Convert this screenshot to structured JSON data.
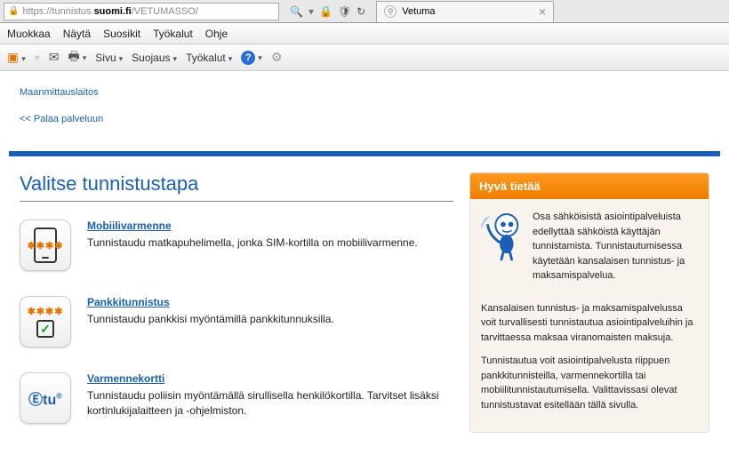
{
  "browser": {
    "url_prefix": "https://tunnistus.",
    "url_bold": "suomi.fi",
    "url_suffix": "/VETUMASSO/",
    "tab_title": "Vetuma"
  },
  "menubar": {
    "items": [
      "Muokkaa",
      "Näytä",
      "Suosikit",
      "Työkalut",
      "Ohje"
    ]
  },
  "toolbar": {
    "page": "Sivu",
    "protect": "Suojaus",
    "tools": "Työkalut"
  },
  "header": {
    "brand": "Maanmittauslaitos",
    "back": "<< Palaa palveluun"
  },
  "section_title": "Valitse tunnistustapa",
  "methods": [
    {
      "title": "Mobiilivarmenne",
      "desc": "Tunnistaudu matkapuhelimella, jonka SIM-kortilla on mobiilivarmenne."
    },
    {
      "title": "Pankkitunnistus",
      "desc": "Tunnistaudu pankkisi myöntämillä pankkitunnuksilla."
    },
    {
      "title": "Varmennekortti",
      "desc": "Tunnistaudu poliisin myöntämällä sirullisella henkilökortilla. Tarvitset lisäksi kortinlukijalaitteen ja -ohjelmiston."
    }
  ],
  "info": {
    "heading": "Hyvä tietää",
    "p1": "Osa sähköisistä asiointipalveluista edellyttää sähköistä käyttäjän tunnistamista. Tunnistautumisessa käytetään kansalaisen tunnistus- ja maksamispalvelua.",
    "p2": "Kansalaisen tunnistus- ja maksamispalvelussa voit turvallisesti tunnistautua asiointipalveluihin ja tarvittaessa maksaa viranomaisten maksuja.",
    "p3": "Tunnistautua voit asiointipalvelusta riippuen pankkitunnisteilla, varmennekortilla tai mobiilitunnistautumisella. Valittavissasi olevat tunnistustavat esitellään tällä sivulla."
  }
}
